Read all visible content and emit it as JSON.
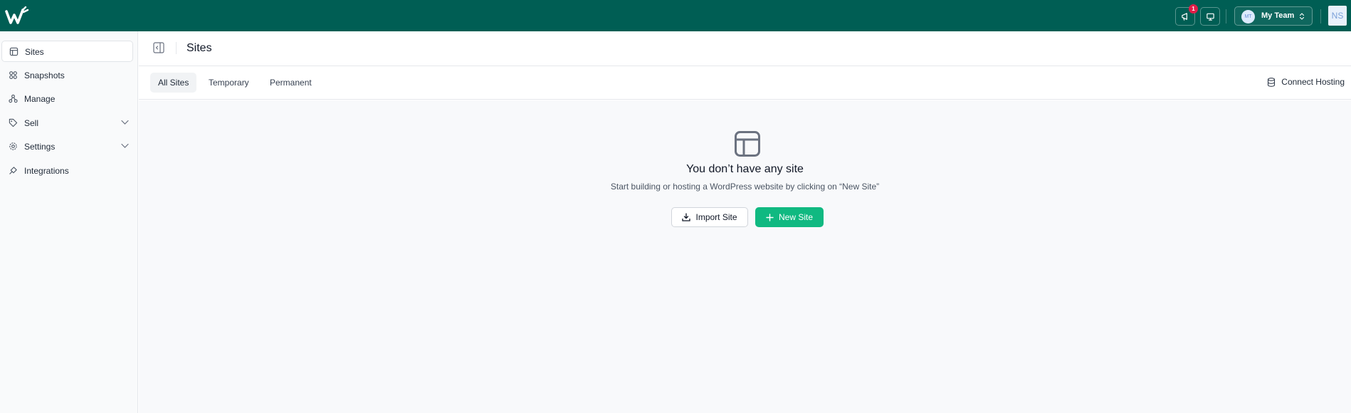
{
  "topbar": {
    "notifications_count": "1",
    "team": {
      "avatar_initials": "MT",
      "name": "My Team"
    },
    "user_initials": "NS"
  },
  "sidebar": {
    "items": [
      {
        "label": "Sites",
        "icon": "layout-icon",
        "active": true
      },
      {
        "label": "Snapshots",
        "icon": "grid-icon"
      },
      {
        "label": "Manage",
        "icon": "nodes-icon"
      },
      {
        "label": "Sell",
        "icon": "tag-icon",
        "expandable": true
      },
      {
        "label": "Settings",
        "icon": "gear-icon",
        "expandable": true
      },
      {
        "label": "Integrations",
        "icon": "plug-icon"
      }
    ]
  },
  "header": {
    "title": "Sites"
  },
  "tabs": {
    "items": [
      {
        "label": "All Sites",
        "active": true
      },
      {
        "label": "Temporary"
      },
      {
        "label": "Permanent"
      }
    ],
    "connect_label": "Connect Hosting"
  },
  "empty_state": {
    "title": "You don’t have any site",
    "subtitle": "Start building or hosting a WordPress website by clicking on “New Site”",
    "import_label": "Import Site",
    "new_label": "New Site"
  },
  "colors": {
    "topbar": "#005e54",
    "accent": "#10b981",
    "badge": "#e11d48"
  }
}
